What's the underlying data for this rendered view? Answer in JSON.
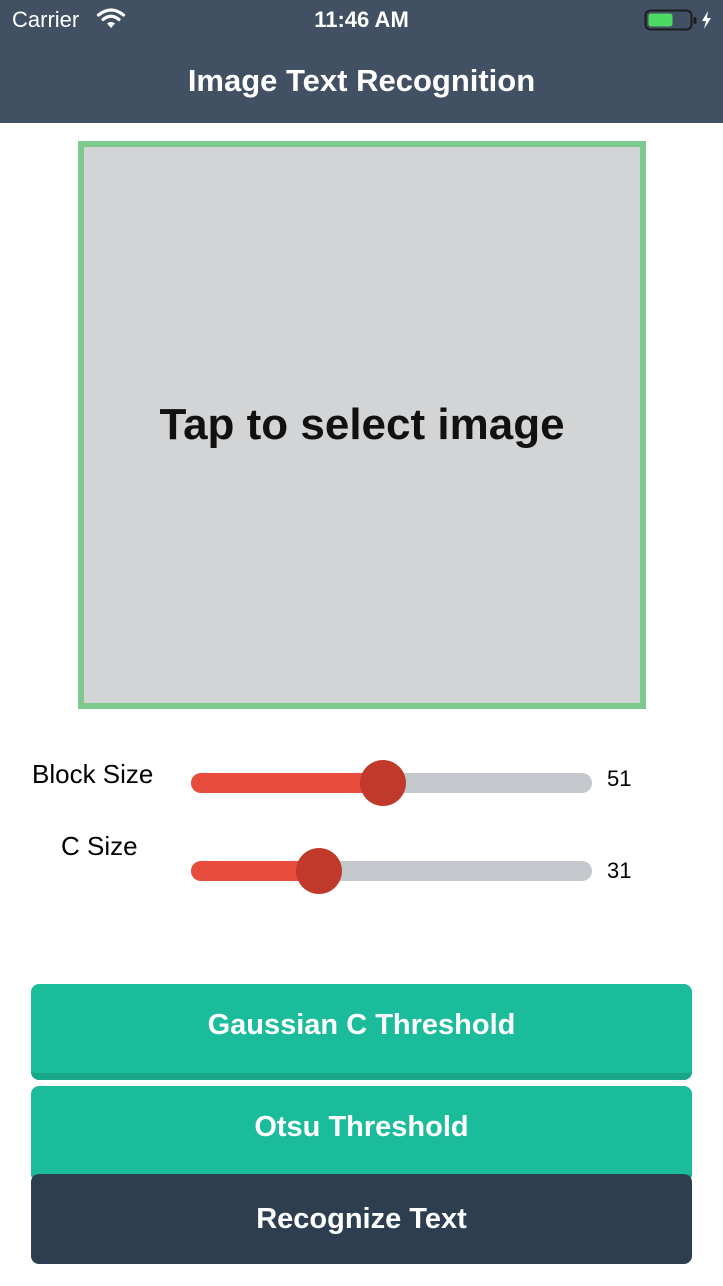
{
  "status_bar": {
    "carrier": "Carrier",
    "time": "11:46 AM",
    "wifi_icon": "wifi-icon",
    "battery_icon": "battery-charging-icon",
    "battery_color": "#4cd964"
  },
  "nav": {
    "title": "Image Text Recognition",
    "background": "#425063"
  },
  "image_picker": {
    "label": "Tap to select image",
    "border_color": "#7ec98e",
    "background": "#d3d4d6"
  },
  "sliders": [
    {
      "label": "Block Size",
      "value": "51",
      "fraction": 0.48
    },
    {
      "label": "C Size",
      "value": "31",
      "fraction": 0.32
    }
  ],
  "buttons": {
    "gaussian": "Gaussian C Threshold",
    "otsu": "Otsu Threshold",
    "recognize": "Recognize Text"
  },
  "colors": {
    "slider_fill": "#e74c3c",
    "slider_thumb": "#c0392b",
    "slider_track": "#c4c8cc",
    "teal_button": "#1abc9c",
    "dark_button": "#2c3e50"
  }
}
